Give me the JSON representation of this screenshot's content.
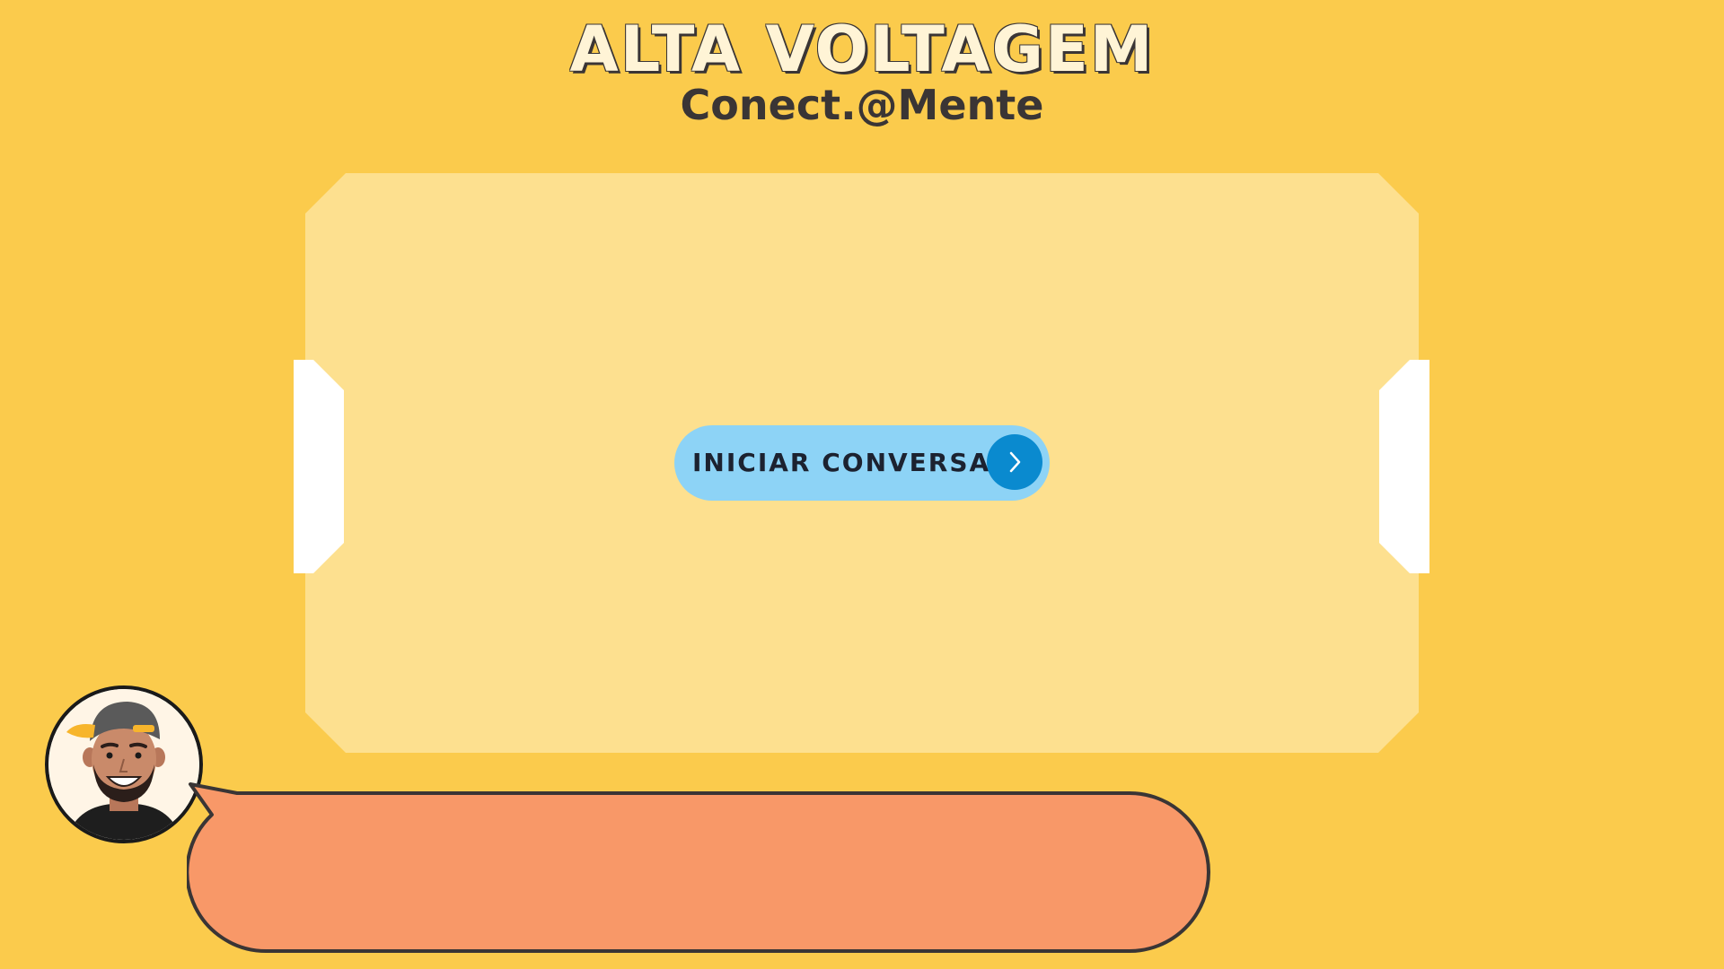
{
  "header": {
    "title": "ALTA VOLTAGEM",
    "subtitle": "Conect.@Mente"
  },
  "main": {
    "start_button_label": "INICIAR CONVERSA",
    "start_button_icon": "chevron-right-icon"
  },
  "speech_bubble": {
    "text": ""
  },
  "colors": {
    "background": "#FBCB4C",
    "panel": "#FDE08F",
    "button": "#8DD3F6",
    "button_icon_bg": "#0A8ACF",
    "speech_bubble": "#F89868",
    "outline": "#3A3535"
  }
}
